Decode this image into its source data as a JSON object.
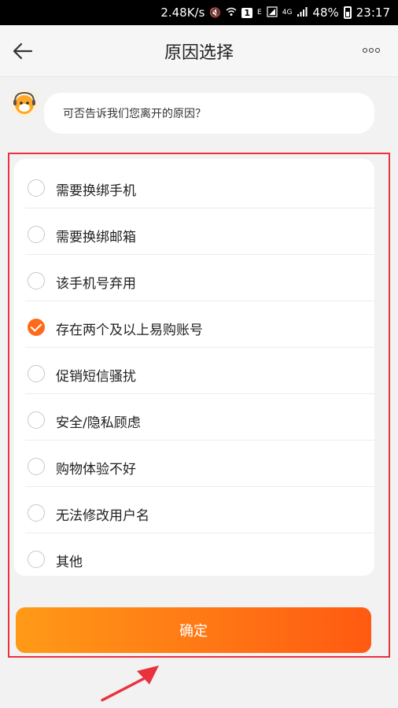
{
  "status_bar": {
    "speed": "2.48K/s",
    "sim": "1",
    "net_e": "E",
    "net_4g": "4G",
    "battery": "48%",
    "time": "23:17"
  },
  "nav": {
    "title": "原因选择"
  },
  "chat": {
    "message": "可否告诉我们您离开的原因？"
  },
  "options": [
    {
      "label": "需要换绑手机",
      "checked": false
    },
    {
      "label": "需要换绑邮箱",
      "checked": false
    },
    {
      "label": "该手机号弃用",
      "checked": false
    },
    {
      "label": "存在两个及以上易购账号",
      "checked": true
    },
    {
      "label": "促销短信骚扰",
      "checked": false
    },
    {
      "label": "安全/隐私顾虑",
      "checked": false
    },
    {
      "label": "购物体验不好",
      "checked": false
    },
    {
      "label": "无法修改用户名",
      "checked": false
    },
    {
      "label": "其他",
      "checked": false
    }
  ],
  "confirm_label": "确定",
  "colors": {
    "accent": "#ff6a1a",
    "highlight": "#e8333f",
    "button_start": "#ff9a17",
    "button_end": "#ff5a12"
  }
}
